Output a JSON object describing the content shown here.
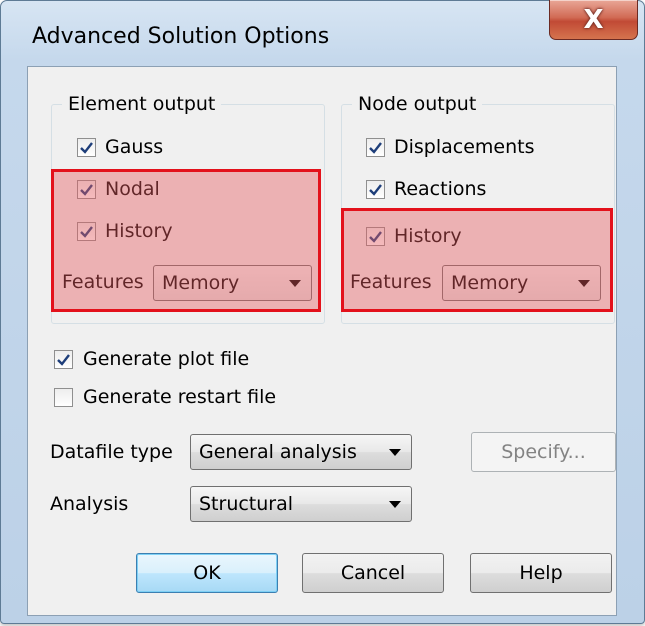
{
  "window": {
    "title": "Advanced Solution Options",
    "close_glyph": "X"
  },
  "element_output": {
    "legend": "Element output",
    "gauss": {
      "label": "Gauss",
      "checked": true
    },
    "nodal": {
      "label": "Nodal",
      "checked": true
    },
    "history": {
      "label": "History",
      "checked": true
    },
    "features_label": "Features",
    "features_value": "Memory"
  },
  "node_output": {
    "legend": "Node output",
    "displacements": {
      "label": "Displacements",
      "checked": true
    },
    "reactions": {
      "label": "Reactions",
      "checked": true
    },
    "history": {
      "label": "History",
      "checked": true
    },
    "features_label": "Features",
    "features_value": "Memory"
  },
  "options": {
    "generate_plot": {
      "label": "Generate plot file",
      "checked": true
    },
    "generate_restart": {
      "label": "Generate restart file",
      "checked": false
    }
  },
  "datafile": {
    "label": "Datafile type",
    "value": "General analysis",
    "specify_label": "Specify..."
  },
  "analysis": {
    "label": "Analysis",
    "value": "Structural"
  },
  "buttons": {
    "ok": "OK",
    "cancel": "Cancel",
    "help": "Help"
  },
  "colors": {
    "highlight_border": "#e3111b",
    "highlight_fill": "#e85a60",
    "titlebar": "#c5d8ec",
    "close_button": "#c14a35"
  },
  "icons": {
    "check": "check-icon",
    "dropdown": "chevron-down-icon",
    "close": "close-icon"
  }
}
